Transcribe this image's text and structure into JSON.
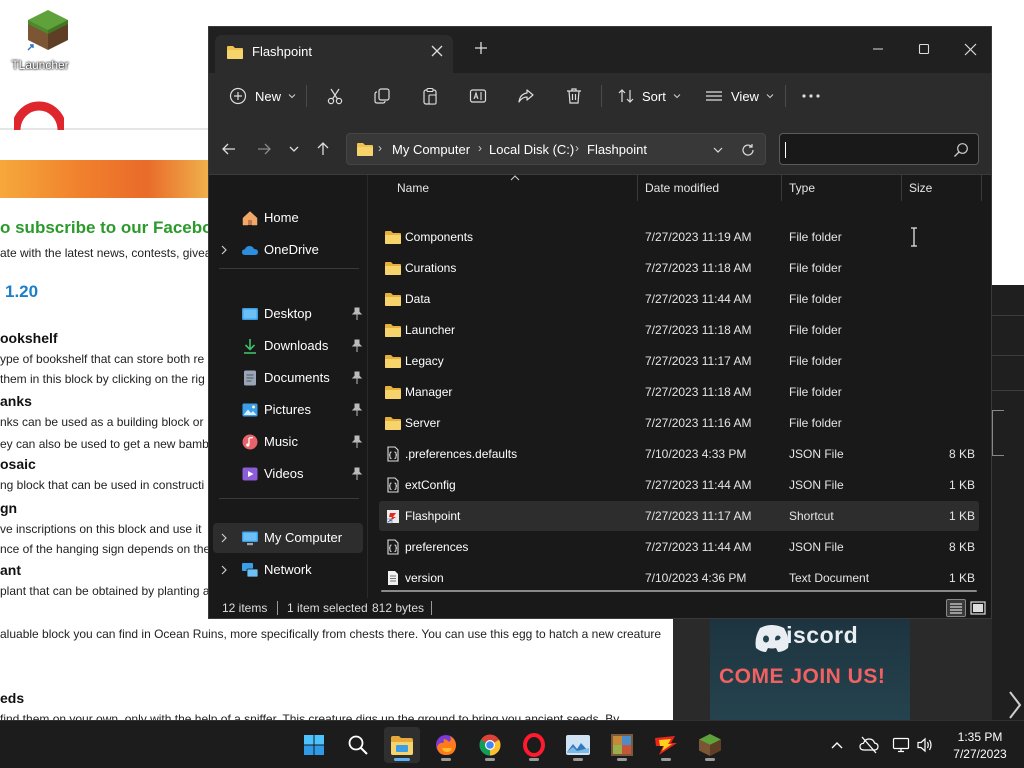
{
  "desktop": {
    "icons": [
      {
        "label": "TLauncher",
        "icon": "minecraft-grass-block-icon"
      },
      {
        "label": "",
        "icon": "opera-icon"
      }
    ]
  },
  "background_page": {
    "subscribe_heading": "o subscribe to our Faceboo",
    "subscribe_text": "ate with the latest news, contests, givea",
    "version_heading": "1.20",
    "lines": [
      {
        "kind": "heading",
        "text": "ookshelf"
      },
      {
        "kind": "text",
        "text": "ype of bookshelf that can store both re"
      },
      {
        "kind": "text",
        "text": "them in this block by clicking on the rig"
      },
      {
        "kind": "heading",
        "text": "anks"
      },
      {
        "kind": "text",
        "text": "nks can be used as a building block or"
      },
      {
        "kind": "text",
        "text": "ey can also be used to get a new bambo"
      },
      {
        "kind": "heading",
        "text": "osaic"
      },
      {
        "kind": "text",
        "text": "ng block that can be used in constructi"
      },
      {
        "kind": "heading",
        "text": "gn"
      },
      {
        "kind": "text",
        "text": "ve inscriptions on this block and use it"
      },
      {
        "kind": "text",
        "text": "nce of the hanging sign depends on the"
      },
      {
        "kind": "heading",
        "text": "ant"
      },
      {
        "kind": "text",
        "text": "plant that can be obtained by planting a"
      },
      {
        "kind": "text",
        "text": "aluable block you can find in Ocean Ruins, more specifically from chests there. You can use this egg to hatch a new creature"
      },
      {
        "kind": "heading",
        "text": "eds"
      },
      {
        "kind": "text",
        "text": "find them on your own, only with the help of a sniffer. This creature digs up the ground to bring you ancient seeds. By"
      }
    ],
    "discord": {
      "word": "Discord",
      "cta": "COME JOIN US!"
    }
  },
  "explorer": {
    "tab": {
      "title": "Flashpoint"
    },
    "toolbar": {
      "new_label": "New",
      "sort_label": "Sort",
      "view_label": "View",
      "more_label": "…"
    },
    "address": {
      "crumbs": [
        "My Computer",
        "Local Disk (C:)",
        "Flashpoint"
      ]
    },
    "search": {
      "placeholder": "",
      "value": ""
    },
    "nav": {
      "home": "Home",
      "onedrive": "OneDrive",
      "desktop": "Desktop",
      "downloads": "Downloads",
      "documents": "Documents",
      "pictures": "Pictures",
      "music": "Music",
      "videos": "Videos",
      "my_computer": "My Computer",
      "network": "Network"
    },
    "columns": {
      "name": "Name",
      "date": "Date modified",
      "type": "Type",
      "size": "Size"
    },
    "files": [
      {
        "name": "Components",
        "date": "7/27/2023 11:19 AM",
        "type": "File folder",
        "size": "",
        "icon": "folder-icon"
      },
      {
        "name": "Curations",
        "date": "7/27/2023 11:18 AM",
        "type": "File folder",
        "size": "",
        "icon": "folder-icon"
      },
      {
        "name": "Data",
        "date": "7/27/2023 11:44 AM",
        "type": "File folder",
        "size": "",
        "icon": "folder-icon"
      },
      {
        "name": "Launcher",
        "date": "7/27/2023 11:18 AM",
        "type": "File folder",
        "size": "",
        "icon": "folder-icon"
      },
      {
        "name": "Legacy",
        "date": "7/27/2023 11:17 AM",
        "type": "File folder",
        "size": "",
        "icon": "folder-icon"
      },
      {
        "name": "Manager",
        "date": "7/27/2023 11:18 AM",
        "type": "File folder",
        "size": "",
        "icon": "folder-icon"
      },
      {
        "name": "Server",
        "date": "7/27/2023 11:16 AM",
        "type": "File folder",
        "size": "",
        "icon": "folder-icon"
      },
      {
        "name": ".preferences.defaults",
        "date": "7/10/2023 4:33 PM",
        "type": "JSON File",
        "size": "8 KB",
        "icon": "json-file-icon"
      },
      {
        "name": "extConfig",
        "date": "7/27/2023 11:44 AM",
        "type": "JSON File",
        "size": "1 KB",
        "icon": "json-file-icon"
      },
      {
        "name": "Flashpoint",
        "date": "7/27/2023 11:17 AM",
        "type": "Shortcut",
        "size": "1 KB",
        "icon": "shortcut-icon",
        "selected": true
      },
      {
        "name": "preferences",
        "date": "7/27/2023 11:44 AM",
        "type": "JSON File",
        "size": "8 KB",
        "icon": "json-file-icon"
      },
      {
        "name": "version",
        "date": "7/10/2023 4:36 PM",
        "type": "Text Document",
        "size": "1 KB",
        "icon": "text-file-icon"
      }
    ],
    "status": {
      "items": "12 items",
      "selected": "1 item selected",
      "bytes": "812 bytes"
    }
  },
  "taskbar": {
    "apps": [
      "start-icon",
      "search-icon",
      "file-explorer-icon",
      "firefox-icon",
      "chrome-icon",
      "opera-icon",
      "photos-icon",
      "game-app-icon",
      "flashpoint-icon",
      "minecraft-icon"
    ],
    "clock": {
      "time": "1:35 PM",
      "date": "7/27/2023"
    }
  },
  "colors": {
    "accent": "#5fb2f2",
    "folder": "#f0c24e",
    "window_bg": "#191919",
    "toolbar_bg": "#2c2c2c"
  }
}
